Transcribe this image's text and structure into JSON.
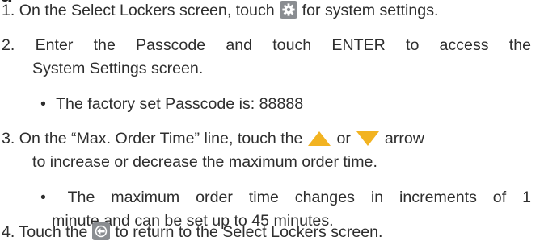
{
  "heading_fragment": "g",
  "steps": [
    {
      "number": "1.",
      "before_icon": "On the Select Lockers screen, touch",
      "icon": "gear-icon",
      "after_icon": "for system settings."
    },
    {
      "number": "2.",
      "line1": "Enter the Passcode and touch ENTER to access the",
      "line2": "System Settings screen.",
      "bullet": "The factory set Passcode is: 88888"
    },
    {
      "number": "3.",
      "line1_before": "On the “Max. Order Time” line, touch the",
      "up_icon": "up-arrow-icon",
      "or_text": "or",
      "down_icon": "down-arrow-icon",
      "line1_after": "arrow",
      "line2": "to increase or decrease the maximum order time.",
      "bullet_line1": "The maximum order time changes in increments of 1",
      "bullet_line2": "minute and can be set up to 45 minutes."
    },
    {
      "number": "4.",
      "before_icon": "Touch the",
      "icon": "back-arrow-icon",
      "after_icon": "to return to the Select Lockers screen."
    }
  ],
  "bullet_symbol": "•",
  "colors": {
    "text": "#2e2e2e",
    "icon_button": "#8a8d91",
    "arrow": "#f2b321"
  }
}
